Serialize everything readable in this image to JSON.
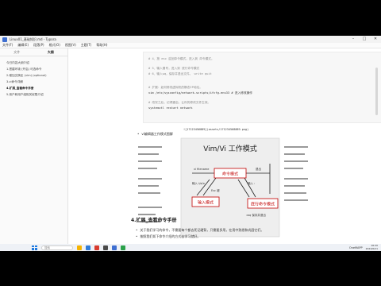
{
  "window": {
    "title": "Linux01_基础知识.md - Typora"
  },
  "menu": [
    "文件(F)",
    "编辑(E)",
    "段落(P)",
    "格式(O)",
    "视图(V)",
    "主题(T)",
    "帮助(H)"
  ],
  "sidebar": {
    "tabs": [
      "文件",
      "大纲"
    ],
    "items": [
      {
        "label": "今日内容大纲介绍"
      },
      {
        "label": "1.搭建环境 (开启) 可选命令"
      },
      {
        "label": "2.增加交换区 (vim) (optional)"
      },
      {
        "label": "3.vi命令详解"
      },
      {
        "label": "4.扩展_查看命令手册"
      },
      {
        "label": "5.用户和用户组相关权限介绍"
      }
    ]
  },
  "code": {
    "lines": [
      {
        "text": "# 4、按 esc 返回命令模式，进入到 命令模式。",
        "kind": "comment"
      },
      {
        "text": "# 5、输入冒号，进入到 底行命令模式",
        "kind": "comment"
      },
      {
        "text": "# 6、输入wq，保存并退出文件。   write quit",
        "kind": "comment"
      },
      {
        "text": "# 扩展：如何修改虚拟机的静态IP地址。",
        "kind": "comment"
      },
      {
        "text": "vim /etc/sysconfig/network-scripts/ifcfg-ens33    # 进入修改操作",
        "kind": "cmd"
      },
      {
        "text": "# 改完之后，记得重启，让你的修改文件生效。",
        "kind": "comment"
      },
      {
        "text": "systemctl restart network",
        "kind": "cmd"
      }
    ]
  },
  "bullets": {
    "diagram_caption": "vi编辑器工作模式图解",
    "image_path": "![17123456889](assets/171234568889.png)",
    "b1": "关于我们学习的命令，不需要每个都去死记硬背，只需要多用，在用中熟悉和巩固它们。",
    "b2": "按照我们如下命令介绍的方式去学习就好。"
  },
  "figure": {
    "title": "Vim/Vi 工作模式",
    "mode_command": "命令模式",
    "mode_insert": "输入模式",
    "mode_last_line": "底行命令模式",
    "labels": {
      "open": "vi filename",
      "enter_insert": "输入 i/a/o",
      "esc": "Esc 键",
      "colon": "输入 : ",
      "quit": "退出",
      "wq": ":wq 保存并退出"
    }
  },
  "section_heading": "4.扩展_查看命令手册",
  "taskbar": {
    "search_placeholder": "搜索",
    "tray_app": "OneMAPP",
    "time": "16:20",
    "date": "2024/6/21"
  }
}
